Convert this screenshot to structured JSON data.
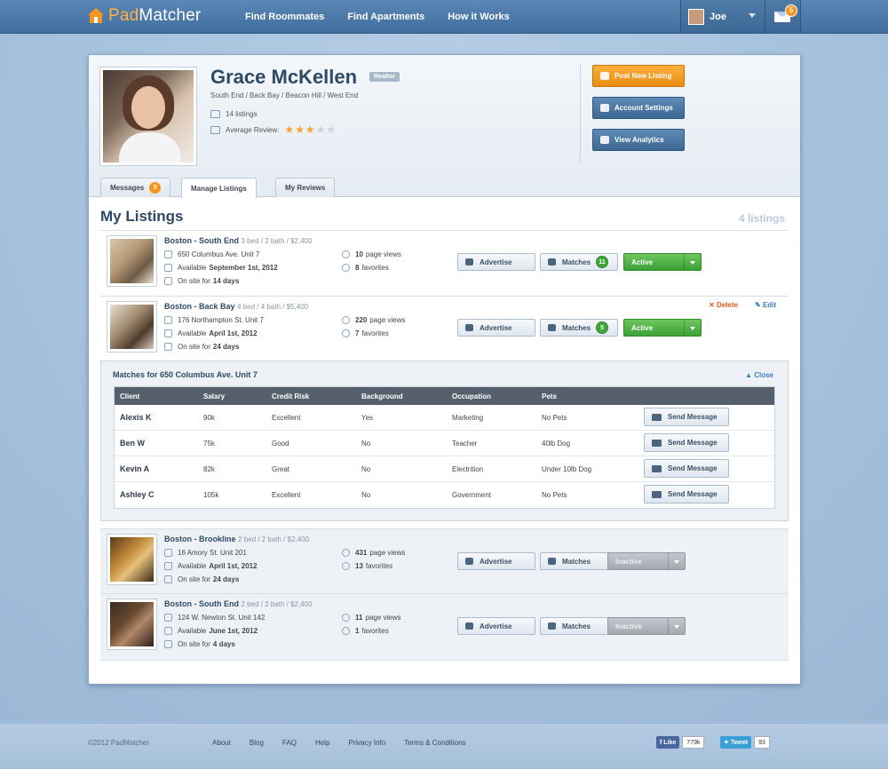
{
  "nav": {
    "logo_pad": "Pad",
    "logo_matcher": "Matcher",
    "links": [
      "Find Roommates",
      "Find Apartments",
      "How it Works"
    ],
    "user_name": "Joe",
    "mail_count": "5"
  },
  "profile": {
    "name": "Grace McKellen",
    "badge": "Realtor",
    "areas": "South End / Back Bay / Beacon Hill / West End",
    "listings": "14 listings",
    "average_review_label": "Average Review:",
    "rating": 3,
    "rating_max": 5
  },
  "actions": {
    "post": "Post New Listing",
    "settings": "Account Settings",
    "analytics": "View Analytics"
  },
  "tabs": {
    "messages": "Messages",
    "messages_count": "5",
    "manage": "Manage Listings",
    "reviews": "My Reviews"
  },
  "section": {
    "title": "My Listings",
    "count": "4 listings"
  },
  "common": {
    "advertise": "Advertise",
    "matches": "Matches",
    "page_views": "page views",
    "favorites": "favorites",
    "available": "Available",
    "on_site_for": "On site for",
    "delete": "Delete",
    "edit": "Edit",
    "close": "Close",
    "send_message": "Send Message"
  },
  "listings": [
    {
      "city": "Boston - South End",
      "specs": "3 bed / 2 bath / $2,400",
      "address": "650 Columbus Ave. Unit 7",
      "available": "September 1st, 2012",
      "onsite": "14 days",
      "views": "10",
      "favorites": "8",
      "matches": "11",
      "status": "Active"
    },
    {
      "city": "Boston - Back Bay",
      "specs": "4 bed / 4 bath / $5,400",
      "address": "176 Northampton St. Unit 7",
      "available": "April 1st, 2012",
      "onsite": "24 days",
      "views": "220",
      "favorites": "7",
      "matches": "5",
      "status": "Active"
    },
    {
      "city": "Boston - Brookline",
      "specs": "2 bed / 2 bath / $2,400",
      "address": "16 Amory St. Unit 201",
      "available": "April 1st, 2012",
      "onsite": "24 days",
      "views": "431",
      "favorites": "13",
      "status": "Inactive"
    },
    {
      "city": "Boston - South End",
      "specs": "2 bed / 2 bath / $2,400",
      "address": "124 W. Newton St. Unit 142",
      "available": "June 1st, 2012",
      "onsite": "4 days",
      "views": "11",
      "favorites": "1",
      "status": "Inactive"
    }
  ],
  "matches_panel": {
    "title": "Matches for 650 Columbus Ave. Unit 7",
    "columns": [
      "Client",
      "Salary",
      "Credit Risk",
      "Background",
      "Occupation",
      "Pets"
    ],
    "rows": [
      [
        "Alexis K",
        "90k",
        "Excellent",
        "Yes",
        "Marketing",
        "No Pets"
      ],
      [
        "Ben W",
        "75k",
        "Good",
        "No",
        "Teacher",
        "40lb Dog"
      ],
      [
        "Kevin A",
        "82k",
        "Great",
        "No",
        "Electrition",
        "Under 10lb Dog"
      ],
      [
        "Ashley C",
        "105k",
        "Excellent",
        "No",
        "Government",
        "No Pets"
      ]
    ]
  },
  "footer": {
    "copyright": "©2012 PadMatcher",
    "links": [
      "About",
      "Blog",
      "FAQ",
      "Help",
      "Privacy Info",
      "Terms & Conditions"
    ],
    "like": "Like",
    "like_count": "779k",
    "tweet": "Tweet",
    "tweet_count": "93"
  },
  "colors": {
    "nav": "#4a78a6",
    "orange": "#f7941d",
    "active_green": "#3fa63a",
    "title_blue": "#2f4a66"
  }
}
